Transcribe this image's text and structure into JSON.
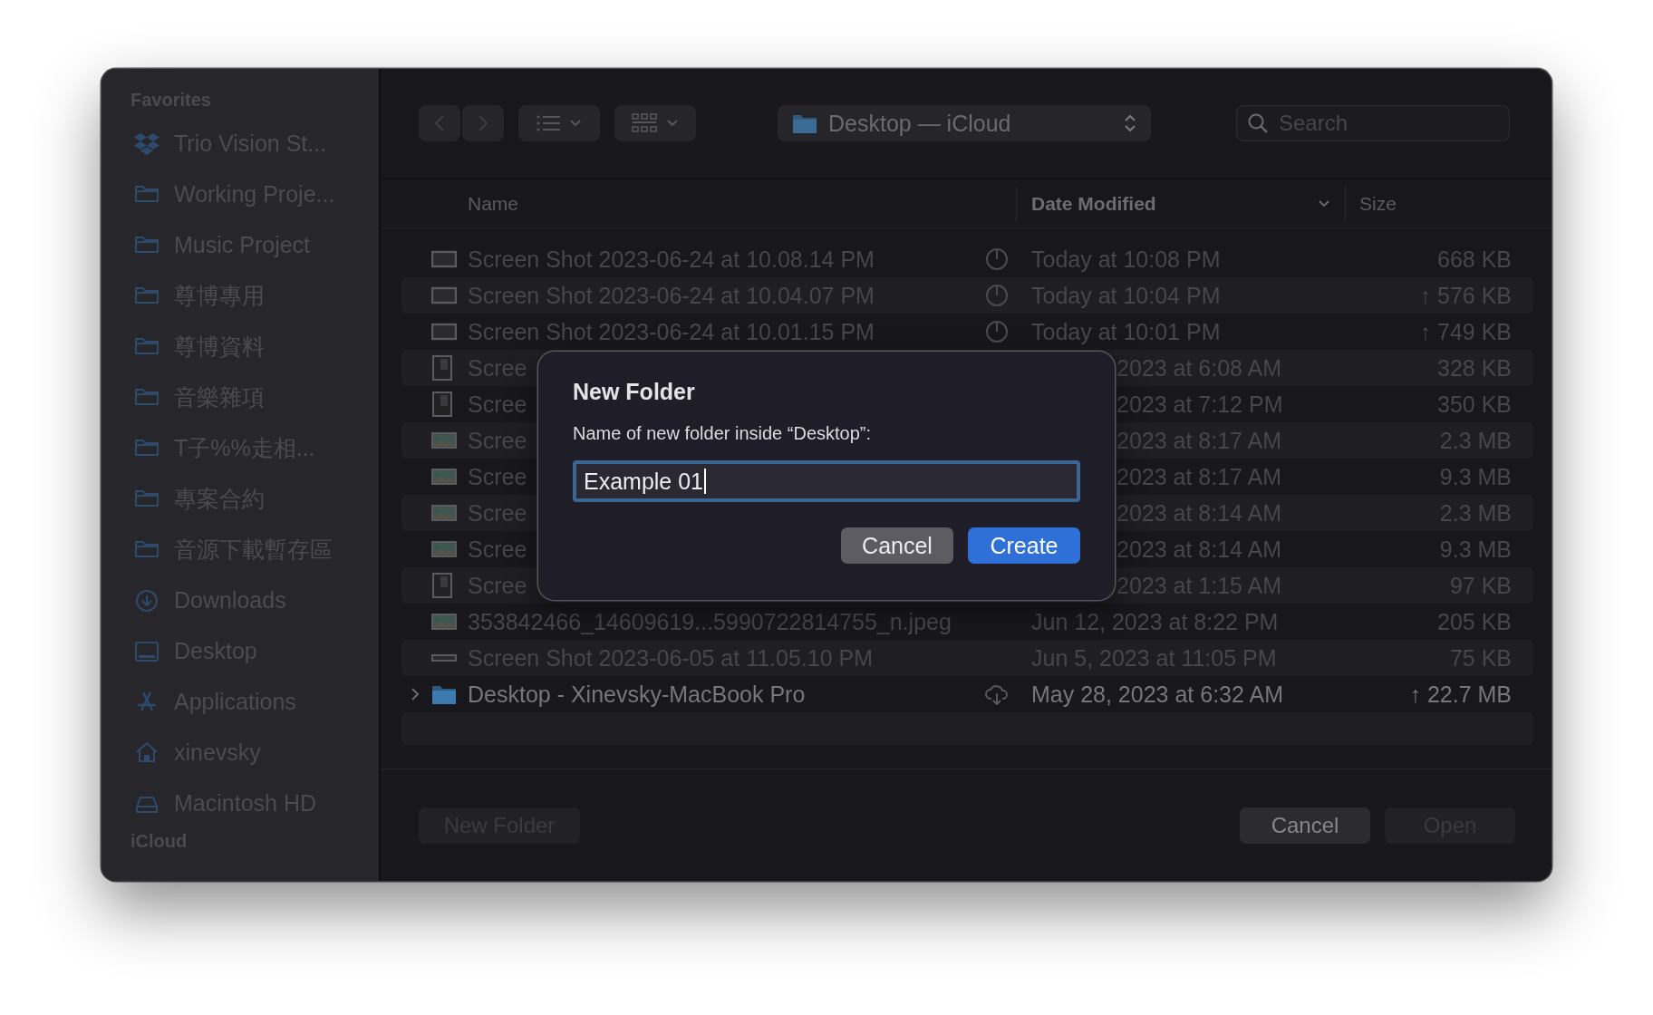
{
  "sidebar": {
    "sections": [
      {
        "title": "Favorites",
        "items": [
          {
            "label": "Trio Vision St...",
            "kind": "dropbox"
          },
          {
            "label": "Working Proje...",
            "kind": "folder"
          },
          {
            "label": "Music Project",
            "kind": "folder"
          },
          {
            "label": "尊博專用",
            "kind": "folder"
          },
          {
            "label": "尊博資料",
            "kind": "folder"
          },
          {
            "label": "音樂雜項",
            "kind": "folder"
          },
          {
            "label": "T子%%走相...",
            "kind": "folder"
          },
          {
            "label": "專案合約",
            "kind": "folder"
          },
          {
            "label": "音源下載暫存區",
            "kind": "folder"
          },
          {
            "label": "Downloads",
            "kind": "downloads"
          },
          {
            "label": "Desktop",
            "kind": "desktop"
          },
          {
            "label": "Applications",
            "kind": "applications"
          },
          {
            "label": "xinevsky",
            "kind": "home"
          },
          {
            "label": "Macintosh HD",
            "kind": "disk"
          }
        ]
      },
      {
        "title": "iCloud"
      }
    ]
  },
  "toolbar": {
    "location": "Desktop — iCloud",
    "search": {
      "placeholder": "Search"
    }
  },
  "table": {
    "columns": [
      {
        "label": "Name",
        "sorted": false
      },
      {
        "label": "Date Modified",
        "sorted": true
      },
      {
        "label": "Size",
        "sorted": false
      }
    ],
    "rows": [
      {
        "name": "Screen Shot 2023-06-24 at 10.08.14 PM",
        "date": "Today at 10:08 PM",
        "size": "668 KB",
        "kind": "screenshot",
        "syncing": true,
        "in_cloud": false,
        "disabled": true,
        "expandable": false
      },
      {
        "name": "Screen Shot 2023-06-24 at 10.04.07 PM",
        "date": "Today at 10:04 PM",
        "size": "↑ 576 KB",
        "kind": "screenshot",
        "syncing": true,
        "in_cloud": false,
        "disabled": true,
        "expandable": false
      },
      {
        "name": "Screen Shot 2023-06-24 at 10.01.15 PM",
        "date": "Today at 10:01 PM",
        "size": "↑ 749 KB",
        "kind": "screenshot",
        "syncing": true,
        "in_cloud": false,
        "disabled": true,
        "expandable": false
      },
      {
        "name": "Scree",
        "date": "2023 at 6:08 AM",
        "size": "328 KB",
        "kind": "document",
        "syncing": false,
        "in_cloud": false,
        "disabled": true,
        "expandable": false
      },
      {
        "name": "Scree",
        "date": "2023 at 7:12 PM",
        "size": "350 KB",
        "kind": "document",
        "syncing": false,
        "in_cloud": false,
        "disabled": true,
        "expandable": false
      },
      {
        "name": "Scree",
        "date": "2023 at 8:17 AM",
        "size": "2.3 MB",
        "kind": "photo",
        "syncing": false,
        "in_cloud": false,
        "disabled": true,
        "expandable": false
      },
      {
        "name": "Scree",
        "date": "2023 at 8:17 AM",
        "size": "9.3 MB",
        "kind": "photo",
        "syncing": false,
        "in_cloud": false,
        "disabled": true,
        "expandable": false
      },
      {
        "name": "Scree",
        "date": "2023 at 8:14 AM",
        "size": "2.3 MB",
        "kind": "photo",
        "syncing": false,
        "in_cloud": false,
        "disabled": true,
        "expandable": false
      },
      {
        "name": "Scree",
        "date": "2023 at 8:14 AM",
        "size": "9.3 MB",
        "kind": "photo",
        "syncing": false,
        "in_cloud": false,
        "disabled": true,
        "expandable": false
      },
      {
        "name": "Scree",
        "date": "2023 at 1:15 AM",
        "size": "97 KB",
        "kind": "document",
        "syncing": false,
        "in_cloud": false,
        "disabled": true,
        "expandable": false
      },
      {
        "name": "353842466_14609619...5990722814755_n.jpeg",
        "date": "Jun 12, 2023 at 8:22 PM",
        "size": "205 KB",
        "kind": "photo",
        "syncing": false,
        "in_cloud": false,
        "disabled": true,
        "expandable": false
      },
      {
        "name": "Screen Shot 2023-06-05 at 11.05.10 PM",
        "date": "Jun 5, 2023 at 11:05 PM",
        "size": "75 KB",
        "kind": "strip",
        "syncing": false,
        "in_cloud": false,
        "disabled": true,
        "expandable": false
      },
      {
        "name": "Desktop - Xinevsky-MacBook Pro",
        "date": "May 28, 2023 at 6:32 AM",
        "size": "↑ 22.7 MB",
        "kind": "folder",
        "syncing": false,
        "in_cloud": true,
        "disabled": false,
        "expandable": true
      }
    ]
  },
  "bottom_bar": {
    "buttons": [
      {
        "label": "New Folder",
        "disabled": true
      },
      {
        "label": "Cancel",
        "disabled": false
      },
      {
        "label": "Open",
        "disabled": true
      }
    ]
  },
  "dialog": {
    "title": "New Folder",
    "prompt": "Name of new folder inside “Desktop”:",
    "value": "Example 01",
    "buttons": [
      {
        "label": "Cancel",
        "default": false
      },
      {
        "label": "Create",
        "default": true
      }
    ]
  }
}
